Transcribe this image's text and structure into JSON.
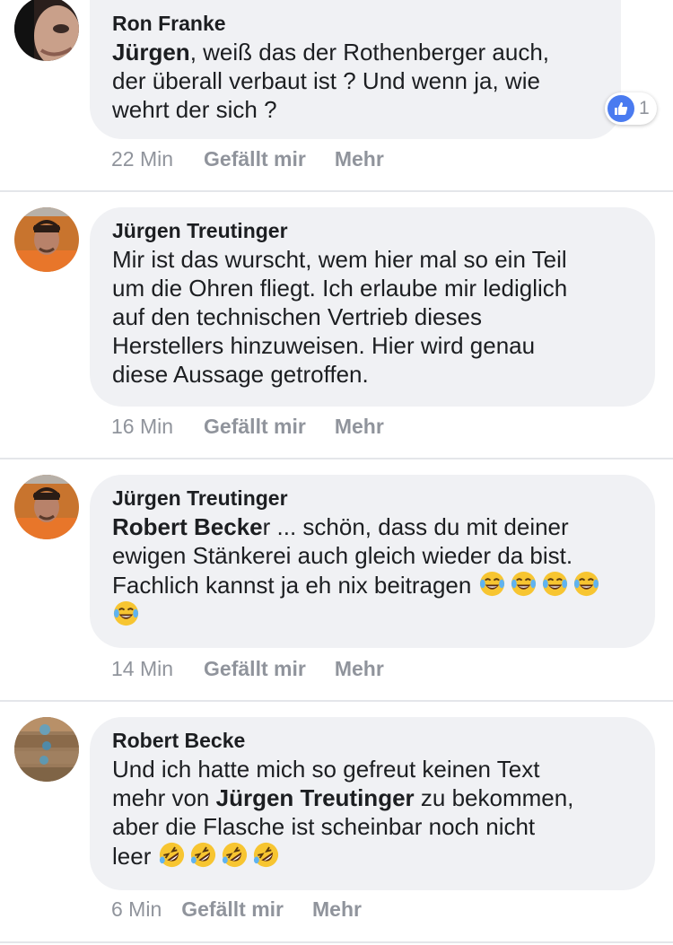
{
  "comments": [
    {
      "author": "Ron Franke",
      "mention": "Jürgen",
      "text": ", weiß das der Rothenberger auch,\nder überall verbaut ist ? Und wenn ja, wie\nwehrt der sich ?",
      "time": "22 Min",
      "like": "Gefällt mir",
      "more": "Mehr",
      "reaction_count": "1",
      "avatar_icon": "ron-franke-avatar"
    },
    {
      "author": "Jürgen Treutinger",
      "text": "Mir ist das wurscht, wem hier mal so ein Teil\num die Ohren fliegt. Ich erlaube mir lediglich\nauf den technischen Vertrieb dieses\nHerstellers hinzuweisen. Hier wird genau\ndiese Aussage getroffen.",
      "time": "16 Min",
      "like": "Gefällt mir",
      "more": "Mehr",
      "avatar_icon": "juergen-treutinger-avatar"
    },
    {
      "author": "Jürgen Treutinger",
      "mention": "Robert Becke",
      "text": "r ... schön, dass du mit deiner\newigen Stänkerei auch gleich wieder da bist.\nFachlich kannst ja eh nix beitragen ",
      "emoji": "tears-of-joy-emoji",
      "time": "14 Min",
      "like": "Gefällt mir",
      "more": "Mehr",
      "avatar_icon": "juergen-treutinger-avatar"
    },
    {
      "author": "Robert Becke",
      "text_before": "Und ich hatte mich so gefreut keinen Text\nmehr von ",
      "mention": "Jürgen Treutinger",
      "text_after": " zu bekommen,\naber die Flasche ist scheinbar noch nicht\nleer ",
      "emoji": "rolling-on-floor-laughing-emoji",
      "time": "6 Min",
      "like": "Gefällt mir",
      "more": "Mehr",
      "avatar_icon": "robert-becke-avatar"
    }
  ],
  "colors": {
    "bubble": "#f0f1f4",
    "meta_text": "#90949c",
    "like_blue": "#4a7bf0",
    "divider": "#e4e6ea"
  }
}
